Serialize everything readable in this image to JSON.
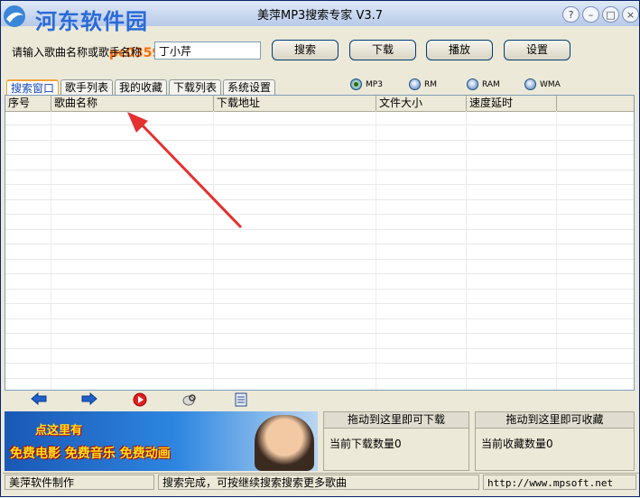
{
  "window": {
    "title": "美萍MP3搜索专家 V3.7",
    "watermark": "河东软件园",
    "watermark_url": "pc0359.cn"
  },
  "toolbar": {
    "search_label": "请输入歌曲名称或歌手名称",
    "search_value": "丁小芹",
    "buttons": [
      "搜索",
      "下载",
      "播放",
      "设置"
    ]
  },
  "tabs": [
    "搜索窗口",
    "歌手列表",
    "我的收藏",
    "下载列表",
    "系统设置"
  ],
  "active_tab": 0,
  "formats": [
    {
      "label": "MP3",
      "checked": true
    },
    {
      "label": "RM",
      "checked": false
    },
    {
      "label": "RAM",
      "checked": false
    },
    {
      "label": "WMA",
      "checked": false
    }
  ],
  "table": {
    "columns": [
      "序号",
      "歌曲名称",
      "下载地址",
      "文件大小",
      "速度延时"
    ],
    "rows": []
  },
  "bottom_icons": [
    "back-arrow-icon",
    "forward-arrow-icon",
    "play-icon",
    "search-disk-icon",
    "document-icon"
  ],
  "banner": {
    "line1": "点这里有",
    "line2": "免费电影 免费音乐 免费动画"
  },
  "download_drop": {
    "header": "拖动到这里即可下载",
    "label": "当前下载数量",
    "count": "0"
  },
  "favorite_drop": {
    "header": "拖动到这里即可收藏",
    "label": "当前收藏数量",
    "count": "0"
  },
  "statusbar": {
    "maker": "美萍软件制作",
    "message": "搜索完成，可按继续搜索搜索更多歌曲",
    "url": "http://www.mpsoft.net"
  }
}
